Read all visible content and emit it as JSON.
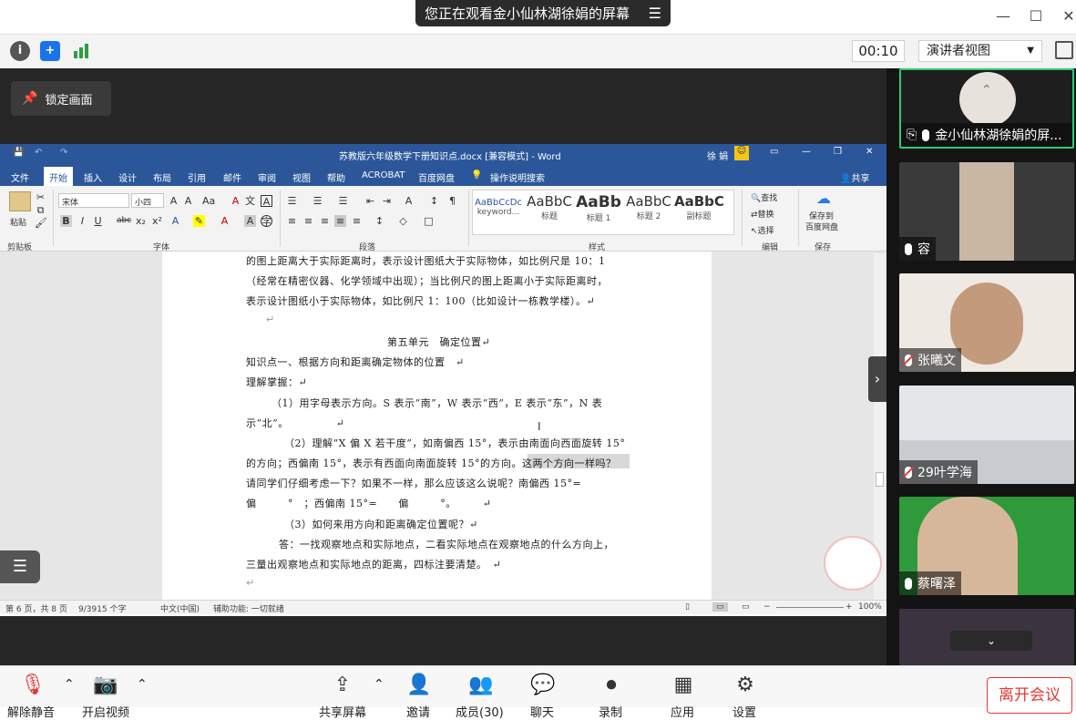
{
  "banner": {
    "text": "您正在观看金小仙林湖徐娟的屏幕",
    "menu_icon": "menu-icon"
  },
  "window_controls": {
    "minimize": "—",
    "maximize": "☐",
    "close": "✕"
  },
  "toolbar": {
    "timer": "00:10",
    "presenter_view": "演讲者视图"
  },
  "lock_screen": {
    "label": "锁定画面"
  },
  "word": {
    "title": "苏教版六年级数学下册知识点.docx [兼容模式] - Word",
    "user": "徐 娟",
    "tabs": [
      "文件",
      "开始",
      "插入",
      "设计",
      "布局",
      "引用",
      "邮件",
      "审阅",
      "视图",
      "帮助",
      "ACROBAT",
      "百度网盘",
      "操作说明搜索"
    ],
    "share": "共享",
    "ribbon": {
      "paste": "粘贴",
      "font_name": "宋体",
      "font_size": "小四",
      "groups": [
        "剪贴板",
        "字体",
        "段落",
        "样式",
        "编辑",
        "保存"
      ],
      "styles": [
        {
          "sample": "AaBbCcDc",
          "label": "keyword..."
        },
        {
          "sample": "AaBbC",
          "label": "标题"
        },
        {
          "sample": "AaBb",
          "label": "标题 1"
        },
        {
          "sample": "AaBbC",
          "label": "标题 2"
        },
        {
          "sample": "AaBbC",
          "label": "副标题"
        }
      ],
      "find": "查找",
      "replace": "替换",
      "select": "选择",
      "save_to": "保存到",
      "baidu": "百度网盘"
    },
    "document_lines": [
      "的图上距离大于实际距离时，表示设计图纸大于实际物体，如比例尺是 10：1",
      "（经常在精密仪器、化学领域中出现）；当比例尺的图上距离小于实际距离时，",
      "表示设计图纸小于实际物体，如比例尺 1：100（比如设计一栋教学楼）。↵",
      "↵",
      "第五单元　确定位置↵",
      "知识点一、根据方向和距离确定物体的位置　↵",
      "理解掌握：↵",
      "（1）用字母表示方向。S 表示“南”，W 表示“西”，E 表示“东”，N 表",
      "示“北”。　　　　　↵",
      "（2）理解“X 偏 X 若干度”，如南偏西 15°，表示由南面向西面旋转 15°",
      "的方向；西偏南 15°，表示有西面向南面旋转 15°的方向。这两个方向一样吗？",
      "请同学们仔细考虑一下？如果不一样，那么应该这么说呢？南偏西 15°=",
      "偏　　　°　；西偏南 15°=　　偏　　　°。　　　↵",
      "（3）如何来用方向和距离确定位置呢？↵",
      "答：一找观察地点和实际地点，二看实际地点在观察地点的什么方向上，",
      "三量出观察地点和实际地点的距离，四标注要清楚。　↵",
      "↵"
    ],
    "status": {
      "page": "第 6 页，共 8 页",
      "words": "9/3915 个字",
      "lang": "中文(中国)",
      "access": "辅助功能: 一切就绪",
      "zoom": "100%"
    }
  },
  "participants": [
    {
      "name": "金小仙林湖徐娟的屏...",
      "mic": "on"
    },
    {
      "name": "容",
      "mic": "on"
    },
    {
      "name": "张曦文",
      "mic": "off"
    },
    {
      "name": "29叶学海",
      "mic": "off"
    },
    {
      "name": "蔡曙泽",
      "mic": "on"
    }
  ],
  "bottom": {
    "mute": "解除静音",
    "video": "开启视频",
    "share": "共享屏幕",
    "invite": "邀请",
    "members": "成员(30)",
    "chat": "聊天",
    "record": "录制",
    "apps": "应用",
    "settings": "设置",
    "leave": "离开会议"
  },
  "colors": {
    "word_blue": "#2b579a",
    "leave_red": "#e53935",
    "panel_dark": "#141414"
  }
}
